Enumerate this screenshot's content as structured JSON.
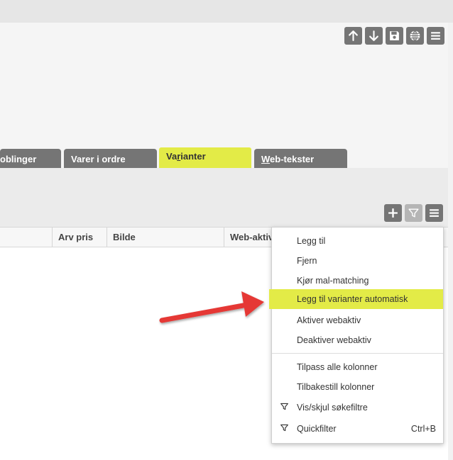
{
  "toolbar_top": {
    "buttons": [
      {
        "icon": "arrow-up-icon"
      },
      {
        "icon": "arrow-down-icon"
      },
      {
        "icon": "save-icon"
      },
      {
        "icon": "globe-icon"
      },
      {
        "icon": "menu-icon"
      }
    ]
  },
  "tabs": [
    {
      "label": "oblinger"
    },
    {
      "label": "Varer i ordre"
    },
    {
      "label_pre": "Va",
      "label_ul": "r",
      "label_post": "ianter",
      "active": true
    },
    {
      "label_pre": "",
      "label_ul": "W",
      "label_post": "eb-tekster"
    }
  ],
  "toolbar2": {
    "buttons": [
      {
        "icon": "plus-icon"
      },
      {
        "icon": "filter-icon"
      },
      {
        "icon": "menu-icon"
      }
    ]
  },
  "columns": [
    "Arv pris",
    "Bilde",
    "Web-aktiv"
  ],
  "context_menu": {
    "items": [
      {
        "label": "Legg til"
      },
      {
        "label": "Fjern"
      },
      {
        "label": "Kjør mal-matching"
      },
      {
        "label": "Legg til varianter automatisk",
        "highlighted": true
      },
      {
        "label": "Aktiver webaktiv"
      },
      {
        "label": "Deaktiver webaktiv"
      },
      {
        "label": "Tilpass alle kolonner"
      },
      {
        "label": "Tilbakestill kolonner"
      },
      {
        "label": "Vis/skjul søkefiltre",
        "icon": "filter-icon"
      },
      {
        "label": "Quickfilter",
        "icon": "filter-icon",
        "shortcut": "Ctrl+B"
      }
    ]
  },
  "colors": {
    "highlight": "#e3eb47",
    "button_gray": "#757575",
    "annotation_arrow": "#e53935"
  }
}
